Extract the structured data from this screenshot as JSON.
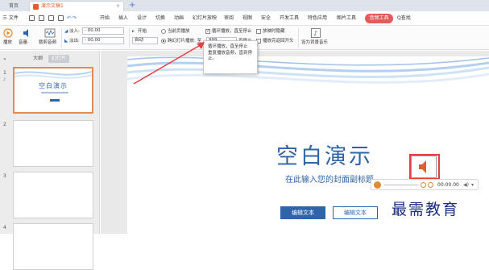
{
  "titlebar": {
    "home_tab": "首页",
    "doc_tab": "演示文稿1",
    "close": "×",
    "new_tab": "+"
  },
  "menu": {
    "file": "三 文件",
    "items": [
      "开始",
      "插入",
      "设计",
      "切换",
      "动画",
      "幻灯片放映",
      "审阅",
      "视图",
      "安全",
      "开发工具",
      "特色应用",
      "图片工具"
    ],
    "active_tab": "音频工具",
    "search": "Q查找"
  },
  "ribbon": {
    "play": "播放",
    "volume": "音量·",
    "crop_audio": "裁剪音频",
    "fade_in_label": "淡入:",
    "fade_in_value": "- 00.00",
    "fade_out_label": "淡出:",
    "fade_out_value": "- 00.00",
    "start_label": "开始",
    "start_value": "自动",
    "current_page_play": "当前页播放",
    "cross_slides_play": "跨幻灯片播放: 至",
    "page_count_value": "999",
    "stop_after_pages": "页停止",
    "loop_play": "循环播放，直至停止",
    "hide_during_show": "放映时隐藏",
    "rewind_after_play": "播放完返回开头",
    "set_background_music": "设为背景音乐"
  },
  "tooltip": {
    "title": "循环播放，直至停止",
    "body": "重复播放音频，直到停止。"
  },
  "left_panel": {
    "tab_outline": "大纲",
    "tab_slides": "幻灯片",
    "slide_numbers": [
      "1",
      "2",
      "3",
      "4"
    ],
    "thumb1_title": "空白演示"
  },
  "slide": {
    "title": "空白演示",
    "subtitle": "在此输入您的封面副标题",
    "button1": "编辑文本",
    "button2": "编辑文本"
  },
  "player": {
    "time": "00:00.00"
  },
  "watermark": "最需教育",
  "colors": {
    "accent": "#e25a5a",
    "slide_blue": "#2f64a8",
    "highlight_red": "#e04040",
    "doc_orange": "#e0602c"
  }
}
